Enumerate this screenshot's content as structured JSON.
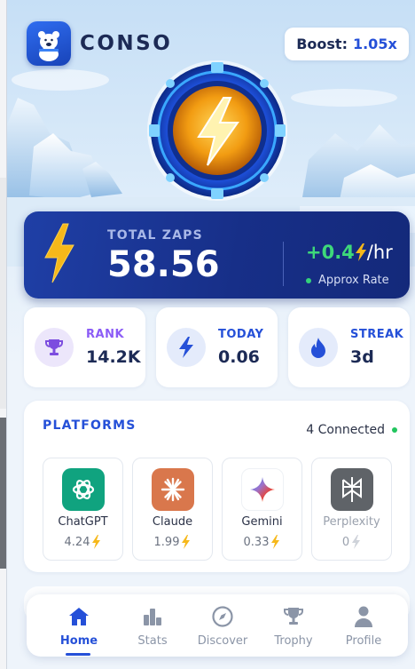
{
  "colors": {
    "brand": "#1c2a55",
    "accent": "#2550d8",
    "zap_card": "#172f88",
    "positive": "#3ed87a",
    "rank": "#8b5cf6",
    "bolt": "#f6b81a"
  },
  "header": {
    "logo_icon": "polar-bear-icon",
    "brand": "CONSO",
    "boost_label": "Boost:",
    "boost_value": "1.05x"
  },
  "medal_icon": "lightning-medal-icon",
  "zaps": {
    "title": "TOTAL ZAPS",
    "value": "58.56",
    "rate_value": "+0.4",
    "rate_unit": "/hr",
    "rate_label": "Approx Rate"
  },
  "stats": [
    {
      "label": "RANK",
      "value": "14.2K",
      "icon": "trophy-icon"
    },
    {
      "label": "TODAY",
      "value": "0.06",
      "icon": "bolt-icon"
    },
    {
      "label": "STREAK",
      "value": "3d",
      "icon": "flame-icon"
    }
  ],
  "platforms": {
    "title": "PLATFORMS",
    "connected": "4 Connected",
    "items": [
      {
        "name": "ChatGPT",
        "score": "4.24",
        "icon": "chatgpt-icon"
      },
      {
        "name": "Claude",
        "score": "1.99",
        "icon": "claude-icon"
      },
      {
        "name": "Gemini",
        "score": "0.33",
        "icon": "gemini-icon"
      },
      {
        "name": "Perplexity",
        "score": "0",
        "icon": "perplexity-icon"
      }
    ]
  },
  "nav": [
    {
      "label": "Home",
      "icon": "home-icon",
      "active": true
    },
    {
      "label": "Stats",
      "icon": "bar-chart-icon"
    },
    {
      "label": "Discover",
      "icon": "compass-icon"
    },
    {
      "label": "Trophy",
      "icon": "trophy-icon"
    },
    {
      "label": "Profile",
      "icon": "user-icon"
    }
  ]
}
